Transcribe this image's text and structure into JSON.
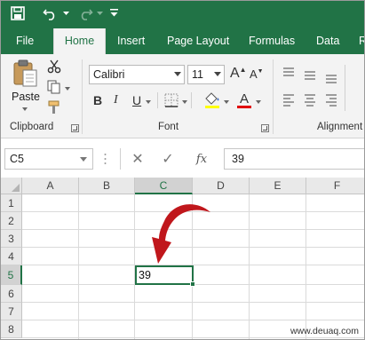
{
  "quick_access": {
    "save_icon": "save-icon",
    "undo_icon": "undo-icon",
    "redo_icon": "redo-icon",
    "customize_icon": "customize-qat-icon"
  },
  "tabs": [
    {
      "label": "File"
    },
    {
      "label": "Home"
    },
    {
      "label": "Insert"
    },
    {
      "label": "Page Layout"
    },
    {
      "label": "Formulas"
    },
    {
      "label": "Data"
    },
    {
      "label": "R"
    }
  ],
  "ribbon": {
    "clipboard": {
      "paste_label": "Paste",
      "group_label": "Clipboard"
    },
    "font": {
      "font_name": "Calibri",
      "font_size": "11",
      "grow_label": "A",
      "shrink_label": "A",
      "bold": "B",
      "italic": "I",
      "underline": "U",
      "color_label": "A",
      "group_label": "Font"
    },
    "alignment": {
      "group_label": "Alignment"
    }
  },
  "formula_bar": {
    "name_box": "C5",
    "cancel_symbol": "✕",
    "enter_symbol": "✓",
    "fx_label": "fx",
    "value": "39"
  },
  "grid": {
    "columns": [
      "A",
      "B",
      "C",
      "D",
      "E",
      "F"
    ],
    "rows": [
      "1",
      "2",
      "3",
      "4",
      "5",
      "6",
      "7",
      "8"
    ],
    "selected_column": "C",
    "selected_row": "5",
    "active_cell_value": "39"
  },
  "colors": {
    "brand": "#217346",
    "arrow": "#c0171c"
  },
  "watermark": "www.deuaq.com"
}
